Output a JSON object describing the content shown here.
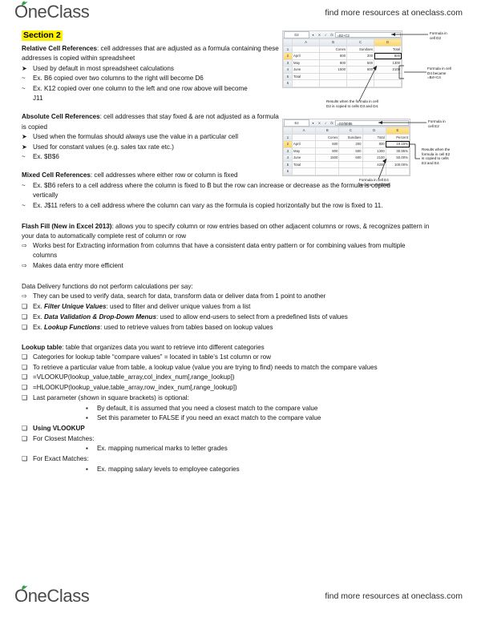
{
  "brand": {
    "logo_text": "OneClass",
    "tagline": "find more resources at oneclass.com"
  },
  "section": {
    "badge": "Section 2"
  },
  "blocks": {
    "relative": {
      "lead": "Relative Cell References",
      "body": ": cell addresses that are adjusted as a formula containing these addresses is copied within spreadsheet",
      "items": [
        {
          "bullet": "➤",
          "level": 1,
          "text": "Used by default in most spreadsheet calculations"
        },
        {
          "bullet": "~",
          "level": 2,
          "text": "Ex. B6 copied over two columns to the right will become D6"
        },
        {
          "bullet": "~",
          "level": 2,
          "text": "Ex. K12 copied over one column to the left and one row above will become J11"
        }
      ]
    },
    "absolute": {
      "lead": "Absolute Cell References",
      "body": ": cell addresses that stay fixed & are not adjusted as a formula is copied",
      "items": [
        {
          "bullet": "➤",
          "level": 1,
          "text": "Used when the formulas should always use the value in a particular cell"
        },
        {
          "bullet": "➤",
          "level": 1,
          "text": "Used for constant values (e.g. sales tax rate etc.)"
        },
        {
          "bullet": "~",
          "level": 2,
          "text": "Ex. $B$6"
        }
      ]
    },
    "mixed": {
      "lead": "Mixed Cell References",
      "body": ": cell addresses where either row or column is fixed",
      "items": [
        {
          "bullet": "~",
          "level": 2,
          "text": "Ex. $B6 refers to a cell address where the column is fixed to B but the row can increase or decrease as the formula is copied vertically"
        },
        {
          "bullet": "~",
          "level": 2,
          "text": "Ex. J$11 refers to a cell address where the column can vary as the formula is copied horizontally but the row is fixed to 11."
        }
      ]
    },
    "flashfill": {
      "lead": "Flash Fill (New in Excel 2013)",
      "body": ": allows you to specify column or row entries based on other adjacent columns or rows, & recognizes pattern in your data to automatically complete rest of column or row",
      "items": [
        {
          "bullet": "⇨",
          "level": 1,
          "text": "Works best for Extracting information from columns that have a consistent data entry pattern or for combining values from multiple columns"
        },
        {
          "bullet": "⇨",
          "level": 1,
          "text": "Makes data entry more efficient"
        }
      ]
    },
    "datadelivery": {
      "lead": "",
      "body": "Data Delivery functions do not perform calculations per say:",
      "items": [
        {
          "bullet": "⇨",
          "level": 1,
          "text": "They can be used to verify data, search for data, transform data or deliver data from 1 point to another"
        },
        {
          "bullet": "❏",
          "level": 1,
          "prefix": "Ex. ",
          "emph": "Filter Unique Values",
          "text": ": used to filter and deliver unique values from a list"
        },
        {
          "bullet": "❏",
          "level": 1,
          "prefix": "Ex. ",
          "emph": "Data Validation & Drop-Down Menus",
          "text": ": used to allow end-users to select from a predefined lists of values"
        },
        {
          "bullet": "❏",
          "level": 1,
          "prefix": "Ex. ",
          "emph": "Lookup Functions",
          "text": ": used to retrieve values from tables based on lookup values"
        }
      ]
    },
    "lookup": {
      "lead": "Lookup table",
      "body": ": table that organizes data you want to retrieve into different categories",
      "items": [
        {
          "bullet": "❏",
          "level": 1,
          "text": "Categories for lookup table “compare values” = located in table’s 1st column or row",
          "sup": "st"
        },
        {
          "bullet": "❏",
          "level": 1,
          "text": "To retrieve a particular value from table, a lookup value (value you are trying to find) needs to match the compare values"
        },
        {
          "bullet": "❑",
          "level": 3,
          "text": "=VLOOKUP(lookup_value,table_array,col_index_num[,range_lookup])"
        },
        {
          "bullet": "❑",
          "level": 3,
          "text": "=HLOOKUP(lookup_value,table_array,row_index_num[,range_lookup])"
        },
        {
          "bullet": "❑",
          "level": 3,
          "text": "Last parameter (shown in square brackets) is optional:"
        },
        {
          "bullet": "▪",
          "level": 4,
          "text": "By default, it is assumed that you need a closest match to the compare value"
        },
        {
          "bullet": "▪",
          "level": 4,
          "text": "Set this parameter to FALSE if you need an exact match to the compare value"
        },
        {
          "bullet": "❏",
          "level": 1,
          "bold": true,
          "text": "Using VLOOKUP"
        },
        {
          "bullet": "❑",
          "level": 3,
          "text": "For Closest Matches:"
        },
        {
          "bullet": "▪",
          "level": 4,
          "text": "Ex. mapping numerical marks to letter grades"
        },
        {
          "bullet": "❑",
          "level": 3,
          "text": "For Exact Matches:"
        },
        {
          "bullet": "▪",
          "level": 4,
          "text": "Ex. mapping salary levels to employee categories"
        }
      ]
    }
  },
  "figures": {
    "relative_example": {
      "namebox": "D2",
      "formula_bar": "=B2+C2",
      "columns": [
        "A",
        "B",
        "C",
        "D"
      ],
      "rows": [
        "1",
        "2",
        "3",
        "4",
        "5",
        "6"
      ],
      "header_row": [
        "",
        "Cones",
        "Sundaes",
        "Total"
      ],
      "data": [
        [
          "April",
          "600",
          "200",
          "800"
        ],
        [
          "May",
          "800",
          "500",
          "1300"
        ],
        [
          "June",
          "1500",
          "600",
          "2100"
        ],
        [
          "Total",
          "",
          "",
          ""
        ]
      ],
      "callouts": [
        {
          "text": "Formula in\ncell D2"
        },
        {
          "text": "Formula in cell\nD4 became\n=B4+C4"
        },
        {
          "text": "Results when the formula in cell\nD2 is copied to cells D3 and D4."
        }
      ]
    },
    "absolute_example": {
      "namebox": "E2",
      "formula_bar": "=D2/$D$5",
      "columns": [
        "A",
        "B",
        "C",
        "D",
        "E"
      ],
      "rows": [
        "1",
        "2",
        "3",
        "4",
        "5",
        "6"
      ],
      "header_row": [
        "",
        "Cones",
        "Sundaes",
        "Total",
        "Percent"
      ],
      "data": [
        [
          "April",
          "600",
          "200",
          "800",
          "19.15%"
        ],
        [
          "May",
          "800",
          "500",
          "1300",
          "30.95%"
        ],
        [
          "June",
          "1500",
          "600",
          "2100",
          "50.00%"
        ],
        [
          "Total",
          "",
          "",
          "4200",
          "100.00%"
        ]
      ],
      "callouts": [
        {
          "text": "Formula in\ncell E2"
        },
        {
          "text": "Results when the\nformula in cell E2\nis copied to cells\nE3 and E4."
        },
        {
          "text": "Formula in cell E4\nbecame =D4/$D$5."
        }
      ]
    }
  }
}
